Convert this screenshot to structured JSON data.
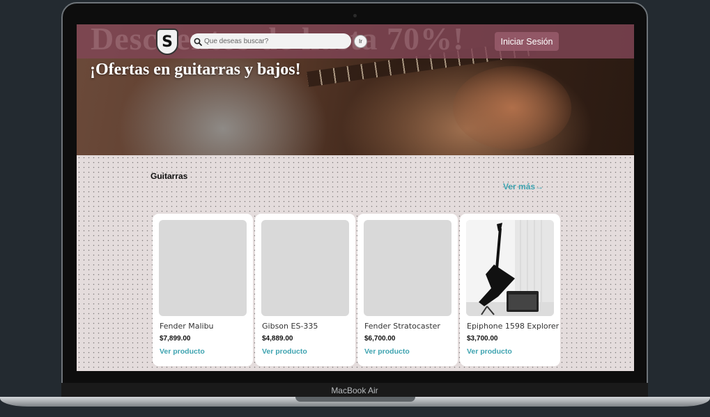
{
  "device": {
    "label": "MacBook Air"
  },
  "header": {
    "background_promo": "Descuentos de hasta 70%!",
    "logo_letter": "S",
    "search_placeholder": "Que deseas buscar?",
    "go_label": "Ir",
    "login_label": "Iniciar Sesión"
  },
  "hero": {
    "title": "¡Ofertas en guitarras y bajos!"
  },
  "section": {
    "title": "Guitarras",
    "see_more": "Ver más→",
    "products": [
      {
        "name": "Fender Malibu",
        "price": "$7,899.00",
        "link": "Ver producto",
        "has_image": false
      },
      {
        "name": "Gibson ES-335",
        "price": "$4,889.00",
        "link": "Ver producto",
        "has_image": false
      },
      {
        "name": "Fender Stratocaster",
        "price": "$6,700.00",
        "link": "Ver producto",
        "has_image": false
      },
      {
        "name": "Epiphone 1598 Explorer",
        "price": "$3,700.00",
        "link": "Ver producto",
        "has_image": true
      }
    ]
  },
  "colors": {
    "header_bg": "#804656",
    "accent_link": "#3ea3b0",
    "section_bg": "#e4dcdc",
    "placeholder_img": "#d9d9d9"
  }
}
